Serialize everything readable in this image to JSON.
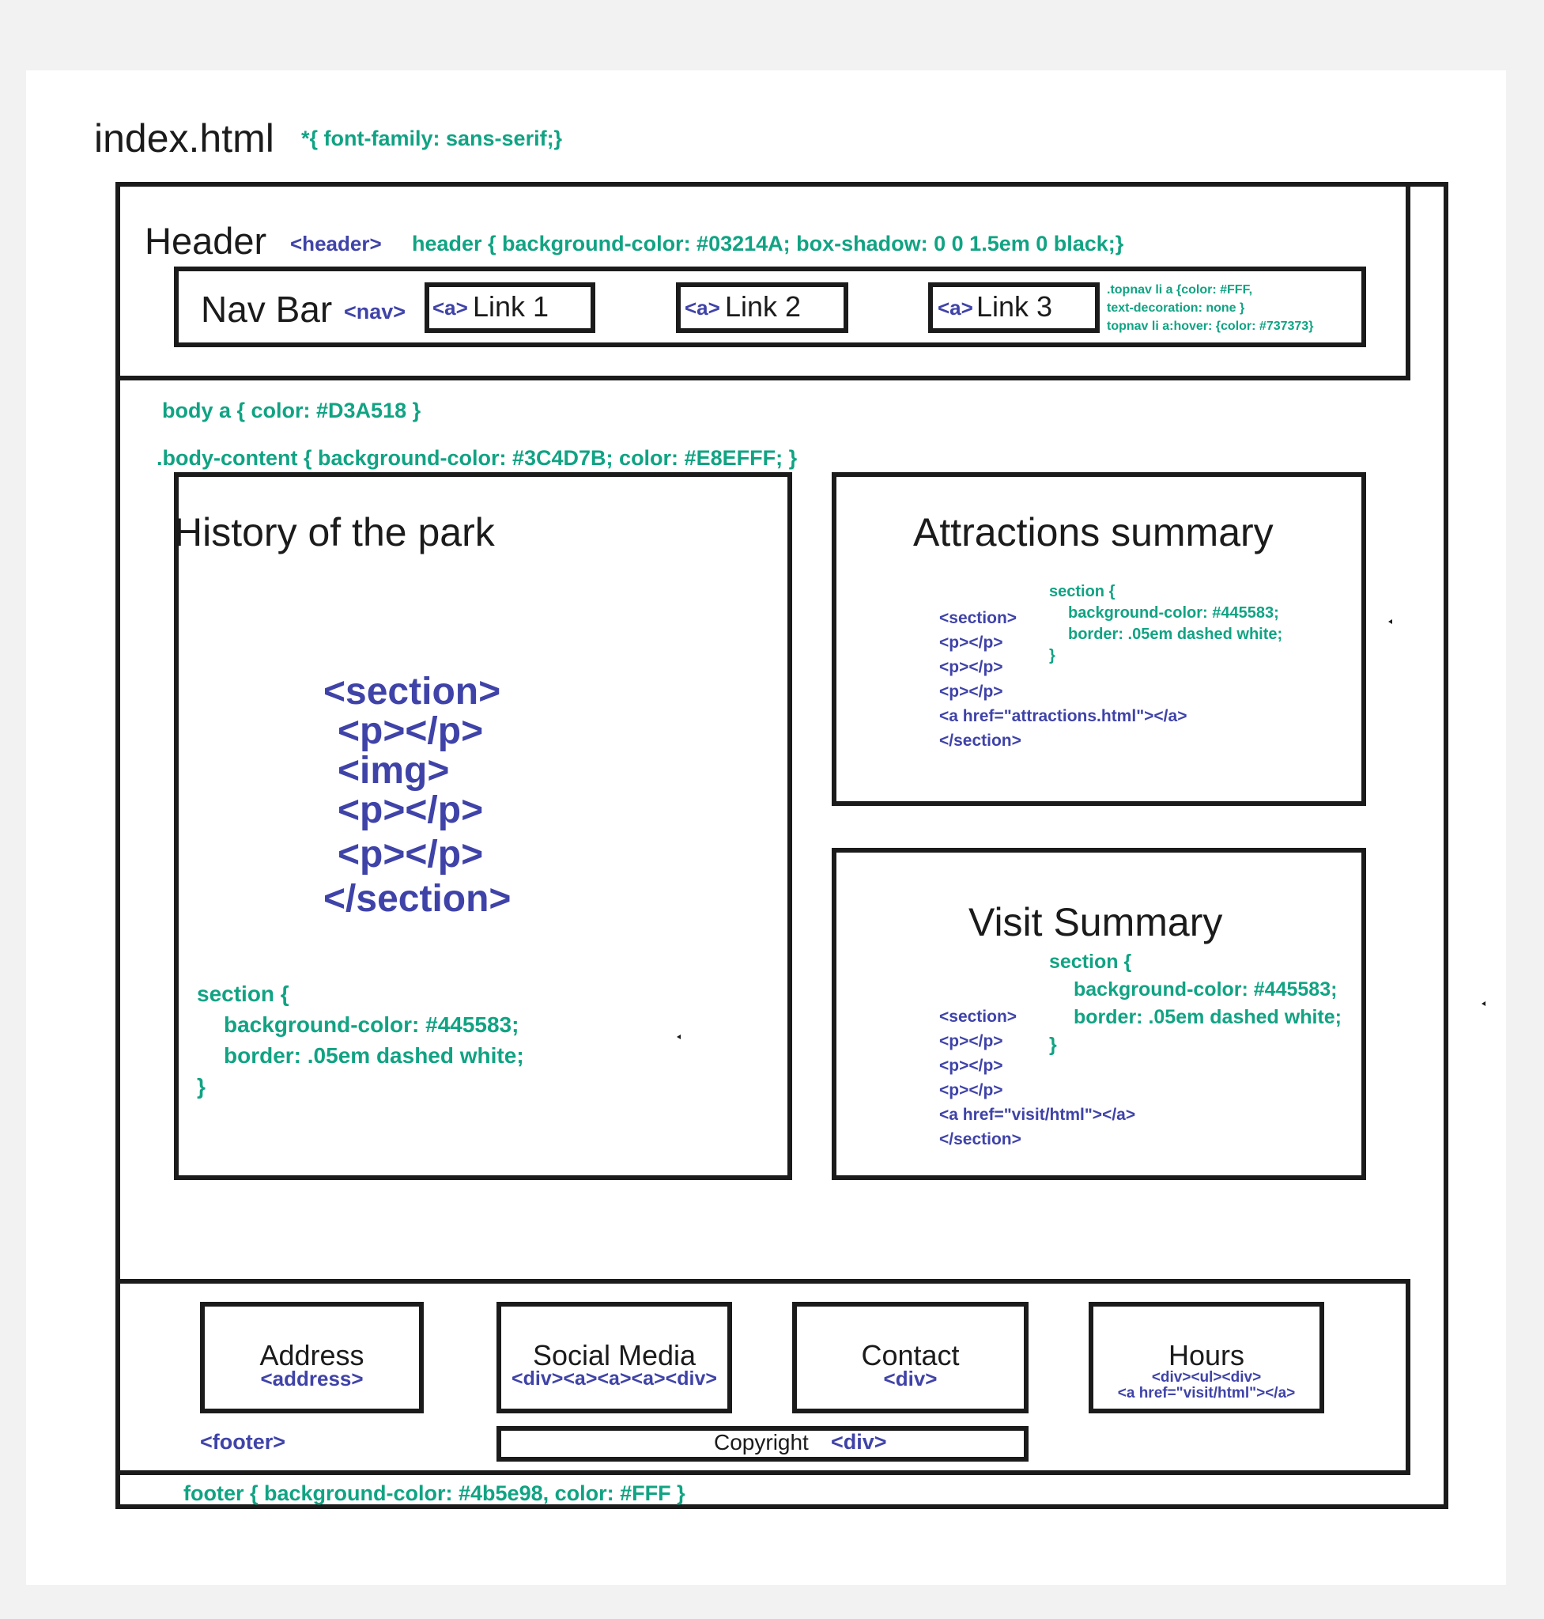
{
  "file": {
    "name": "index.html",
    "global_css": "*{ font-family: sans-serif;}"
  },
  "header": {
    "title": "Header",
    "tag": "<header>",
    "css": "header { background-color: #03214A; box-shadow: 0 0 1.5em 0 black;}"
  },
  "nav": {
    "title": "Nav Bar",
    "tag": "<nav>",
    "links": [
      {
        "tag": "<a>",
        "label": "Link 1"
      },
      {
        "tag": "<a>",
        "label": "Link 2"
      },
      {
        "tag": "<a>",
        "label": "Link 3"
      }
    ],
    "css_lines": [
      ".topnav li a {color: #FFF,",
      "text-decoration: none }",
      "topnav li a:hover: {color: #737373}"
    ]
  },
  "body": {
    "link_css": "body a { color: #D3A518 }",
    "content_css": ".body-content { background-color: #3C4D7B; color: #E8EFFF; }"
  },
  "history": {
    "title": "History of the park",
    "markup_lines": [
      "<section>",
      "<p></p>",
      "<img>",
      "<p></p>",
      "<p></p>",
      "</section>"
    ],
    "css_lines": [
      "section {",
      "background-color: #445583;",
      "border: .05em dashed white;",
      "}"
    ]
  },
  "attractions": {
    "title": "Attractions summary",
    "markup_lines": [
      "<section>",
      "<p></p>",
      "<p></p>",
      "<p></p>",
      "<a href=\"attractions.html\"></a>",
      "</section>"
    ],
    "css_lines": [
      "section {",
      "background-color: #445583;",
      "border: .05em dashed white;",
      "}"
    ]
  },
  "visit": {
    "title": "Visit Summary",
    "markup_lines": [
      "<section>",
      "<p></p>",
      "<p></p>",
      "<p></p>",
      "<a href=\"visit/html\"></a>",
      "</section>"
    ],
    "css_lines": [
      "section {",
      "background-color: #445583;",
      "border: .05em dashed white;",
      "}"
    ]
  },
  "footer": {
    "tag": "<footer>",
    "css": "footer { background-color: #4b5e98, color: #FFF }",
    "address": {
      "label": "Address",
      "tag": "<address>"
    },
    "social": {
      "label": "Social Media",
      "tag": "<div><a><a><a><div>"
    },
    "contact": {
      "label": "Contact",
      "tag": "<div>"
    },
    "hours": {
      "label": "Hours",
      "tag_lines": [
        "<div><ul><div>",
        "<a href=\"visit/html\"></a>"
      ]
    },
    "copyright": {
      "label": "Copyright",
      "tag": "<div>"
    }
  },
  "colors": {
    "annotation_css": "#11a383",
    "annotation_html": "#3f43a8",
    "outline": "#1b1b1b",
    "canvas": "#ffffff",
    "background": "#f2f2f2"
  }
}
